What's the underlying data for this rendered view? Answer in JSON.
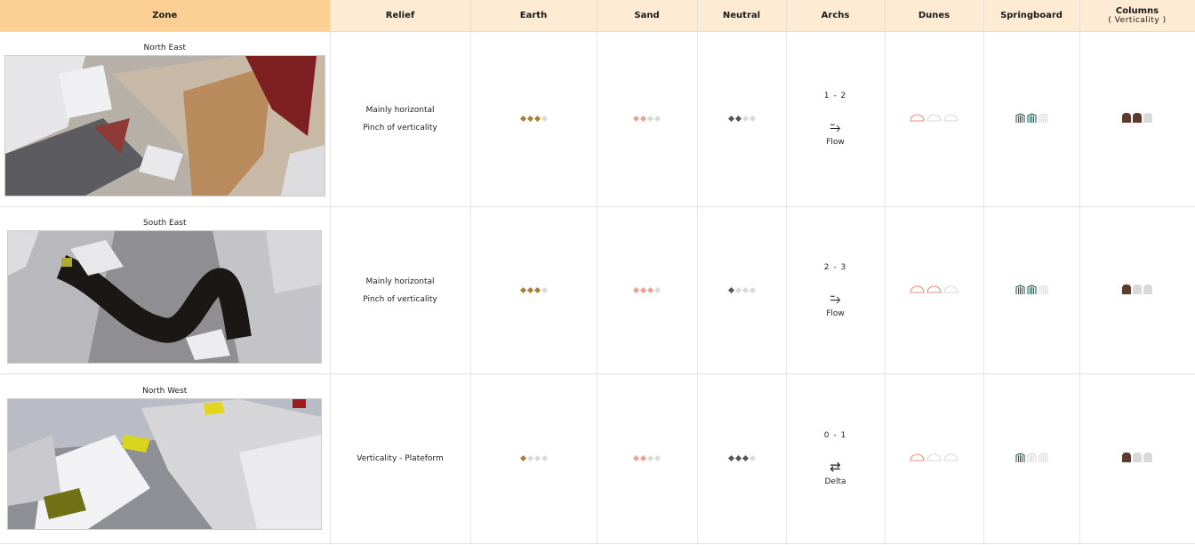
{
  "columns": {
    "zone": "Zone",
    "relief": "Relief",
    "earth": "Earth",
    "sand": "Sand",
    "neutral": "Neutral",
    "archs": "Archs",
    "dunes": "Dunes",
    "springboard": "Springboard",
    "columns": "Columns",
    "columns_sub": "( Verticality )"
  },
  "colors": {
    "header_bg": "#fdebd3",
    "zone_header_bg": "#fccf94",
    "earth": "#a9802b",
    "sand": "#e9a192",
    "neutral": "#555555",
    "empty": "#d9d9d9",
    "dune": "#e98f86",
    "spring_active": "#2e5c52",
    "column": "#5c3b2a"
  },
  "rows": [
    {
      "zone": "North East",
      "relief": [
        "Mainly horizontal",
        "Pinch of verticality"
      ],
      "earth": [
        1,
        1,
        1,
        0
      ],
      "sand": [
        1,
        1,
        0,
        0
      ],
      "neutral": [
        1,
        1,
        0,
        0
      ],
      "archs_range": "1 - 2",
      "archs_icon": "⥲",
      "archs_label": "Flow",
      "dunes": [
        1,
        0,
        0
      ],
      "springboard": [
        1,
        1,
        0
      ],
      "columns": [
        1,
        1,
        0
      ]
    },
    {
      "zone": "South East",
      "relief": [
        "Mainly horizontal",
        "Pinch of verticality"
      ],
      "earth": [
        1,
        1,
        1,
        0
      ],
      "sand": [
        1,
        1,
        1,
        0
      ],
      "neutral": [
        1,
        0,
        0,
        0
      ],
      "archs_range": "2 - 3",
      "archs_icon": "⥲",
      "archs_label": "Flow",
      "dunes": [
        1,
        1,
        0
      ],
      "springboard": [
        1,
        1,
        0
      ],
      "columns": [
        1,
        0,
        0
      ]
    },
    {
      "zone": "North West",
      "relief": [
        "Verticality - Plateform"
      ],
      "earth": [
        1,
        0,
        0,
        0
      ],
      "sand": [
        1,
        1,
        0,
        0
      ],
      "neutral": [
        1,
        1,
        1,
        0
      ],
      "archs_range": "0 - 1",
      "archs_icon": "⇄",
      "archs_label": "Delta",
      "dunes": [
        1,
        0,
        0
      ],
      "springboard": [
        1,
        0,
        0
      ],
      "columns": [
        1,
        0,
        0
      ]
    }
  ]
}
